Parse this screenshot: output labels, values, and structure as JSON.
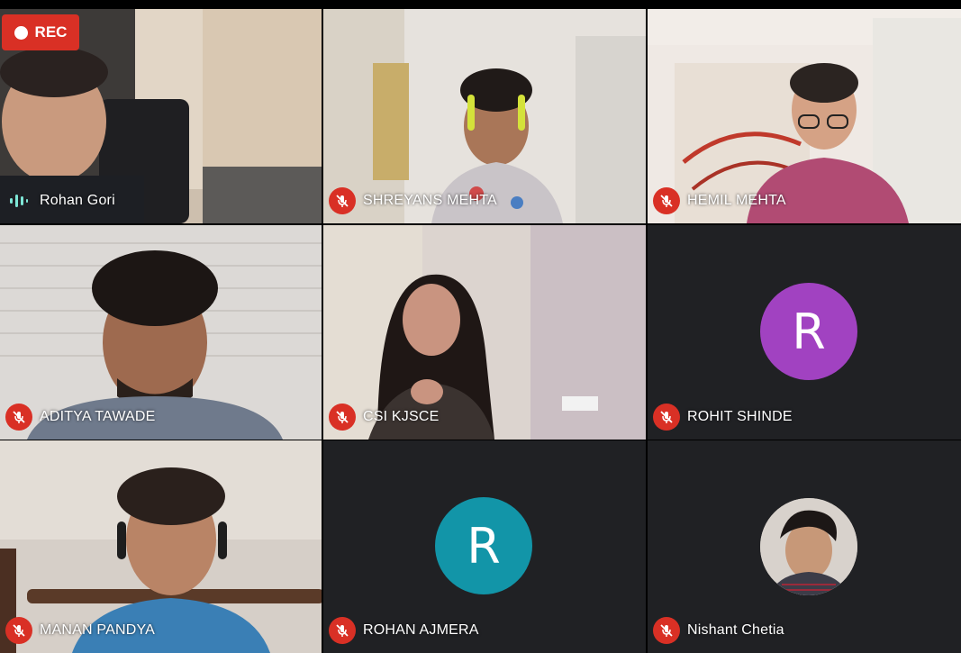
{
  "recording": {
    "label": "REC"
  },
  "participants": [
    {
      "name": "Rohan Gori",
      "mic": "speaking"
    },
    {
      "name": "SHREYANS MEHTA",
      "mic": "muted"
    },
    {
      "name": "HEMIL MEHTA",
      "mic": "muted"
    },
    {
      "name": "ADITYA TAWADE",
      "mic": "muted"
    },
    {
      "name": "CSI KJSCE",
      "mic": "muted"
    },
    {
      "name": "ROHIT SHINDE",
      "mic": "muted",
      "avatar_letter": "R",
      "avatar_color": "#a142c1"
    },
    {
      "name": "MANAN PANDYA",
      "mic": "muted"
    },
    {
      "name": "ROHAN AJMERA",
      "mic": "muted",
      "avatar_letter": "R",
      "avatar_color": "#1295a8"
    },
    {
      "name": "Nishant Chetia",
      "mic": "muted"
    }
  ]
}
